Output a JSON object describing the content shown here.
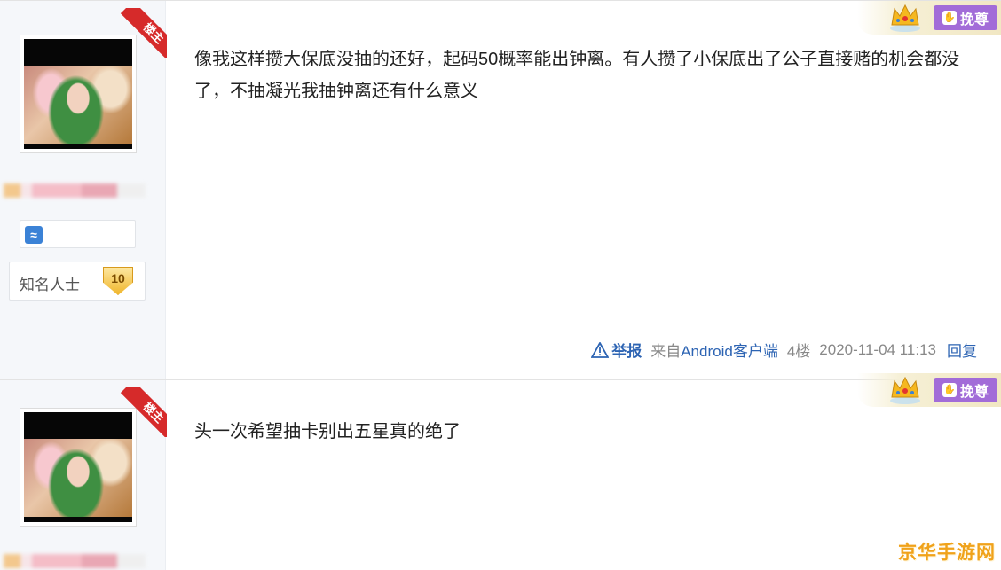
{
  "colors": {
    "link": "#2d64b3",
    "ribbon": "#d62a2a",
    "vote": "#a26cd8",
    "level_badge": "#f0b62c",
    "watermark": "#f0a21a"
  },
  "posts": [
    {
      "op_ribbon": "楼主",
      "user": {
        "title": "知名人士",
        "level": "10"
      },
      "vote_label": "挽尊",
      "content": "像我这样攒大保底没抽的还好，起码50概率能出钟离。有人攒了小保底出了公子直接赌的机会都没了，不抽凝光我抽钟离还有什么意义",
      "meta": {
        "report": "举报",
        "source_prefix": "来自",
        "source_client": "Android客户端",
        "floor": "4楼",
        "timestamp": "2020-11-04 11:13",
        "reply": "回复"
      }
    },
    {
      "op_ribbon": "楼主",
      "vote_label": "挽尊",
      "content": "头一次希望抽卡别出五星真的绝了"
    }
  ],
  "watermark": "京华手游网",
  "icons": {
    "report": "warning-triangle-icon",
    "crown": "crown-icon",
    "vote": "hand-icon",
    "badge": "wave-icon"
  }
}
